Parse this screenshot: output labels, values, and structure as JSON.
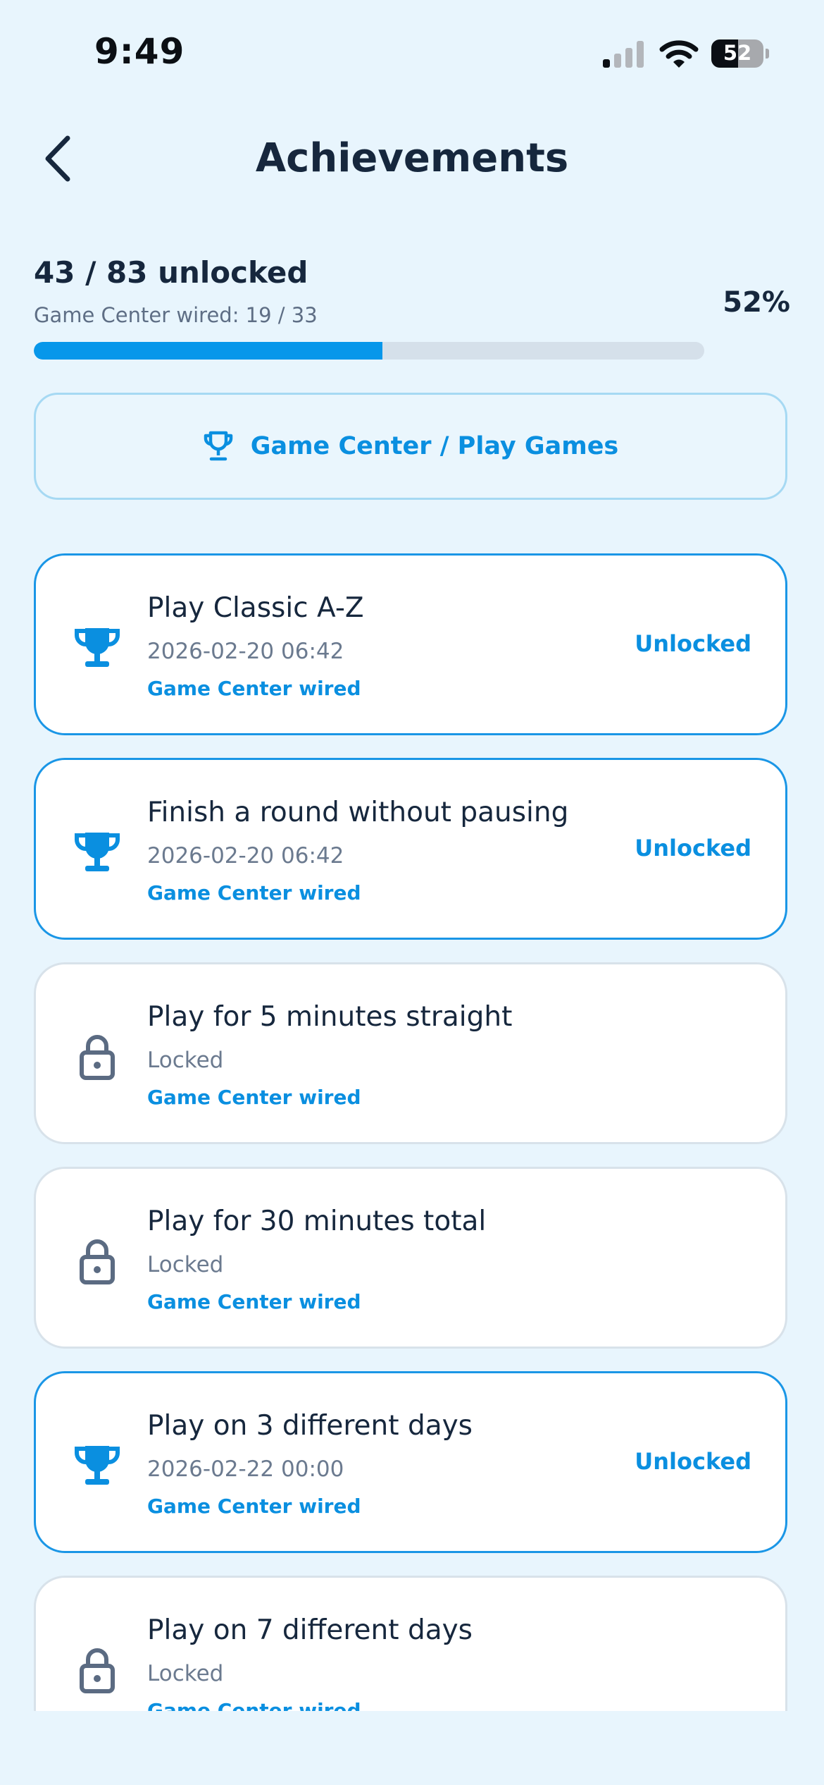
{
  "status_bar": {
    "time": "9:49",
    "battery": "52",
    "battery_level": 0.52
  },
  "header": {
    "title": "Achievements"
  },
  "summary": {
    "unlocked_text": "43 / 83 unlocked",
    "wired_text": "Game Center wired: 19 / 33",
    "percent_text": "52%",
    "progress_fraction": 0.52
  },
  "game_center_button": {
    "label": "Game Center / Play Games",
    "icon": "trophy-outline-icon"
  },
  "achievements": [
    {
      "name": "Play Classic A-Z",
      "sub": "2026-02-20 06:42",
      "wired": "Game Center wired",
      "status": "Unlocked",
      "unlocked": true,
      "icon": "trophy-icon"
    },
    {
      "name": "Finish a round without pausing",
      "sub": "2026-02-20 06:42",
      "wired": "Game Center wired",
      "status": "Unlocked",
      "unlocked": true,
      "icon": "trophy-icon"
    },
    {
      "name": "Play for 5 minutes straight",
      "sub": "Locked",
      "wired": "Game Center wired",
      "status": "",
      "unlocked": false,
      "icon": "lock-icon"
    },
    {
      "name": "Play for 30 minutes total",
      "sub": "Locked",
      "wired": "Game Center wired",
      "status": "",
      "unlocked": false,
      "icon": "lock-icon"
    },
    {
      "name": "Play on 3 different days",
      "sub": "2026-02-22 00:00",
      "wired": "Game Center wired",
      "status": "Unlocked",
      "unlocked": true,
      "icon": "trophy-icon"
    },
    {
      "name": "Play on 7 different days",
      "sub": "Locked",
      "wired": "Game Center wired",
      "status": "",
      "unlocked": false,
      "icon": "lock-icon"
    }
  ],
  "colors": {
    "background": "#e8f5fd",
    "accent": "#0a8fe0",
    "progress_fill": "#0797ea",
    "locked_icon": "#5b6b82",
    "title": "#16273d"
  }
}
